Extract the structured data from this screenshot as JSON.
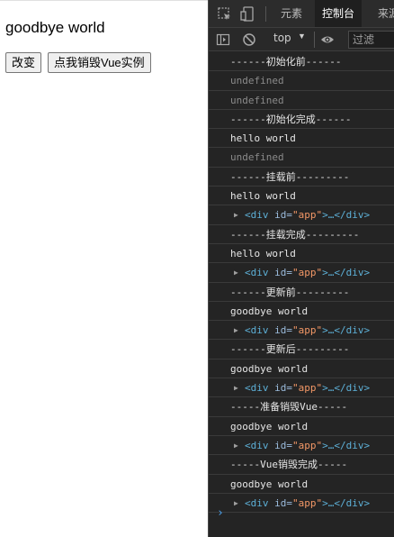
{
  "page": {
    "message": "goodbye world",
    "buttons": [
      "改变",
      "点我销毁Vue实例"
    ]
  },
  "devtools": {
    "tabs": [
      "元素",
      "控制台",
      "来源"
    ],
    "active_tab": "控制台",
    "toolbar": {
      "context": "top",
      "filter_placeholder": "过滤"
    },
    "console_rows": [
      {
        "type": "log",
        "text": "------初始化前------"
      },
      {
        "type": "undef",
        "text": "undefined"
      },
      {
        "type": "undef",
        "text": "undefined"
      },
      {
        "type": "log",
        "text": "------初始化完成------"
      },
      {
        "type": "log",
        "text": "hello world"
      },
      {
        "type": "undef",
        "text": "undefined"
      },
      {
        "type": "log",
        "text": "------挂载前---------"
      },
      {
        "type": "log",
        "text": "hello world"
      },
      {
        "type": "el",
        "tag_open": "<div ",
        "attr_name": "id=",
        "attr_value": "\"app\"",
        "rest": ">…</div>"
      },
      {
        "type": "log",
        "text": "------挂载完成---------"
      },
      {
        "type": "log",
        "text": "hello world"
      },
      {
        "type": "el",
        "tag_open": "<div ",
        "attr_name": "id=",
        "attr_value": "\"app\"",
        "rest": ">…</div>"
      },
      {
        "type": "log",
        "text": "------更新前---------"
      },
      {
        "type": "log",
        "text": "goodbye world"
      },
      {
        "type": "el",
        "tag_open": "<div ",
        "attr_name": "id=",
        "attr_value": "\"app\"",
        "rest": ">…</div>"
      },
      {
        "type": "log",
        "text": "------更新后---------"
      },
      {
        "type": "log",
        "text": "goodbye world"
      },
      {
        "type": "el",
        "tag_open": "<div ",
        "attr_name": "id=",
        "attr_value": "\"app\"",
        "rest": ">…</div>"
      },
      {
        "type": "log",
        "text": "-----准备销毁Vue-----"
      },
      {
        "type": "log",
        "text": "goodbye world"
      },
      {
        "type": "el",
        "tag_open": "<div ",
        "attr_name": "id=",
        "attr_value": "\"app\"",
        "rest": ">…</div>"
      },
      {
        "type": "log",
        "text": "-----Vue销毁完成-----"
      },
      {
        "type": "log",
        "text": "goodbye world"
      },
      {
        "type": "el",
        "tag_open": "<div ",
        "attr_name": "id=",
        "attr_value": "\"app\"",
        "rest": ">…</div>"
      }
    ],
    "prompt": "›"
  }
}
